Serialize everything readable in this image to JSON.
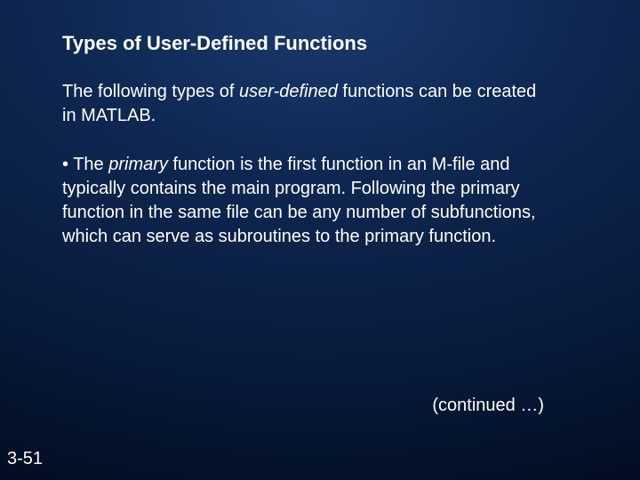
{
  "title": "Types of User-Defined Functions",
  "intro_pre": "The following types of ",
  "intro_italic": "user-defined",
  "intro_post": " functions can be created in MATLAB.",
  "bullet_mark": "•",
  "bullet_pre": " The ",
  "bullet_italic": "primary",
  "bullet_post": " function is the first function in an M-file and typically contains the main  program. Following the primary function in the same file can be any number of subfunctions, which can serve as subroutines to the primary function.",
  "continued": "(continued …)",
  "page": "3-51"
}
